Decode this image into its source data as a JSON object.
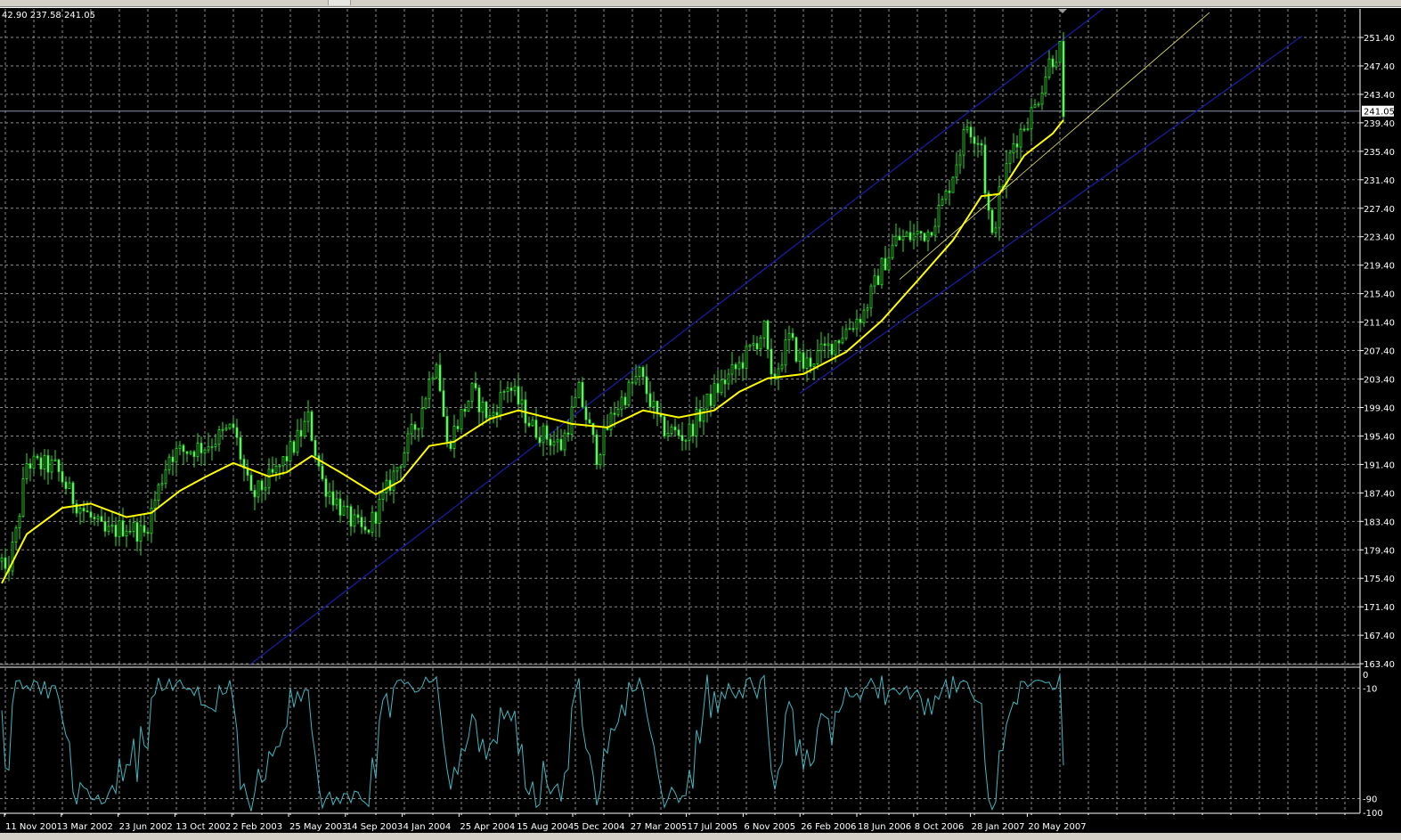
{
  "header": {
    "ohlc_text": "42.90 237.58 241.05"
  },
  "colors": {
    "background": "#000000",
    "bars": "#33dd33",
    "ma": "#ffff00",
    "channel": "#1a1aa0",
    "trendline": "#e8e870",
    "oscillator": "#3fb8c0",
    "grid": "#8a8a8a"
  },
  "chart_data": {
    "type": "candlestick",
    "title": "",
    "price_axis": {
      "min": 163.4,
      "max": 251.4,
      "step": 4,
      "ticks": [
        "251.40",
        "247.40",
        "243.40",
        "239.40",
        "235.40",
        "231.40",
        "227.40",
        "223.40",
        "219.40",
        "215.40",
        "211.40",
        "207.40",
        "203.40",
        "199.40",
        "195.40",
        "191.40",
        "187.40",
        "183.40",
        "179.40",
        "175.40",
        "171.40",
        "167.40",
        "163.40"
      ]
    },
    "current_price": {
      "value": 241.05,
      "label": "241.05"
    },
    "date_labels": [
      "11 Nov 2001",
      "3 Mar 2002",
      "23 Jun 2002",
      "13 Oct 2002",
      "2 Feb 2003",
      "25 May 2003",
      "14 Sep 2003",
      "4 Jan 2004",
      "25 Apr 2004",
      "15 Aug 2004",
      "5 Dec 2004",
      "27 Mar 2005",
      "17 Jul 2005",
      "6 Nov 2005",
      "26 Feb 2006",
      "18 Jun 2006",
      "8 Oct 2006",
      "28 Jan 2007",
      "20 May 2007"
    ],
    "weeks_per_label": 16,
    "price_path_week_close": [
      [
        0,
        177.8
      ],
      [
        1,
        175.3
      ],
      [
        4,
        181.6
      ],
      [
        7,
        191.6
      ],
      [
        15,
        191
      ],
      [
        20,
        186.6
      ],
      [
        29,
        181.6
      ],
      [
        35,
        182.8
      ],
      [
        40,
        181.6
      ],
      [
        47,
        192.8
      ],
      [
        57,
        194
      ],
      [
        65,
        196.6
      ],
      [
        70,
        186.6
      ],
      [
        77,
        190.3
      ],
      [
        82,
        194
      ],
      [
        86,
        197.8
      ],
      [
        90,
        189
      ],
      [
        97,
        184
      ],
      [
        102,
        181.6
      ],
      [
        107,
        186.6
      ],
      [
        117,
        197.8
      ],
      [
        122,
        206.6
      ],
      [
        125,
        194
      ],
      [
        132,
        201.6
      ],
      [
        137,
        197.8
      ],
      [
        142,
        202.7
      ],
      [
        149,
        196.6
      ],
      [
        157,
        194
      ],
      [
        162,
        201.6
      ],
      [
        167,
        192.8
      ],
      [
        172,
        199
      ],
      [
        179,
        204.1
      ],
      [
        185,
        196.6
      ],
      [
        192,
        195.3
      ],
      [
        200,
        201.6
      ],
      [
        207,
        205.3
      ],
      [
        214,
        210.3
      ],
      [
        216,
        202.8
      ],
      [
        221,
        209
      ],
      [
        225,
        205.3
      ],
      [
        232,
        207.8
      ],
      [
        242,
        212.8
      ],
      [
        247,
        219.1
      ],
      [
        251,
        222.9
      ],
      [
        260,
        224.1
      ],
      [
        265,
        229.1
      ],
      [
        271,
        239.1
      ],
      [
        275,
        236.6
      ],
      [
        276,
        230.4
      ],
      [
        278,
        222.9
      ],
      [
        280,
        229.1
      ],
      [
        284,
        236.6
      ],
      [
        290,
        241.6
      ],
      [
        294,
        247.9
      ],
      [
        297,
        249.8
      ],
      [
        298,
        239.1
      ]
    ],
    "moving_average": [
      [
        0,
        174.7
      ],
      [
        7,
        181.6
      ],
      [
        17,
        185.3
      ],
      [
        25,
        185.9
      ],
      [
        35,
        184
      ],
      [
        42,
        184.6
      ],
      [
        50,
        187.7
      ],
      [
        57,
        189.6
      ],
      [
        65,
        191.6
      ],
      [
        75,
        189.7
      ],
      [
        80,
        190.3
      ],
      [
        87,
        192.6
      ],
      [
        95,
        190.3
      ],
      [
        105,
        187.2
      ],
      [
        112,
        189.1
      ],
      [
        120,
        194
      ],
      [
        127,
        194.6
      ],
      [
        137,
        197.8
      ],
      [
        145,
        199
      ],
      [
        160,
        197.1
      ],
      [
        170,
        196.6
      ],
      [
        180,
        199
      ],
      [
        190,
        198
      ],
      [
        200,
        199
      ],
      [
        207,
        201.6
      ],
      [
        215,
        203.5
      ],
      [
        225,
        204.1
      ],
      [
        237,
        207.2
      ],
      [
        247,
        211.6
      ],
      [
        257,
        217.2
      ],
      [
        267,
        222.9
      ],
      [
        275,
        229.1
      ],
      [
        280,
        229.4
      ],
      [
        287,
        234.8
      ],
      [
        295,
        237.9
      ],
      [
        298,
        239.8
      ]
    ],
    "channel_upper": [
      [
        70,
        163.4
      ],
      [
        309,
        255.4
      ]
    ],
    "channel_lower": [
      [
        224,
        201.4
      ],
      [
        365,
        251.6
      ]
    ],
    "trendline": [
      [
        252,
        217.4
      ],
      [
        339,
        254.9
      ]
    ],
    "oscillator": {
      "min": -100,
      "max": 0,
      "ticks": [
        "0",
        "-10",
        "-90",
        "-100"
      ],
      "levels": [
        -10,
        -90
      ],
      "period": 14
    }
  }
}
